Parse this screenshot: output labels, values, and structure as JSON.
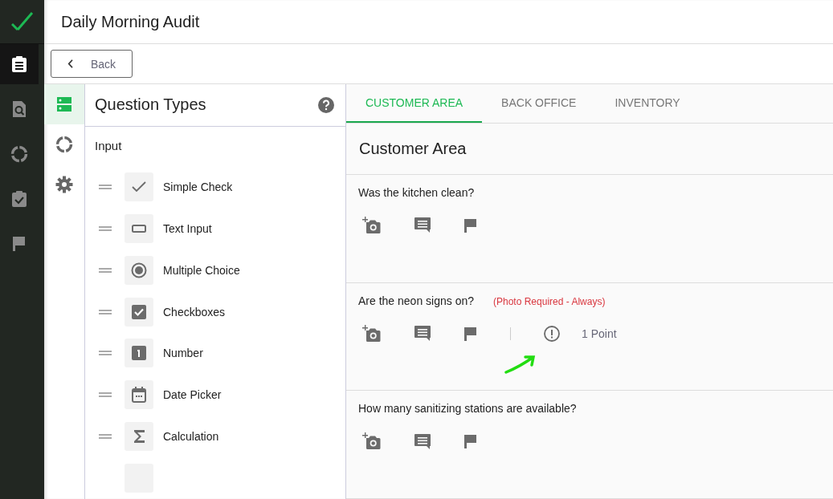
{
  "header": {
    "title": "Daily Morning Audit"
  },
  "back_button": {
    "label": "Back"
  },
  "nav": [
    {
      "kind": "clipboard",
      "selected": true
    },
    {
      "kind": "search",
      "selected": false
    },
    {
      "kind": "ring",
      "selected": false
    },
    {
      "kind": "check",
      "selected": false
    },
    {
      "kind": "flag",
      "selected": false
    }
  ],
  "side_tabs": [
    {
      "kind": "list",
      "selected": true
    },
    {
      "kind": "ring",
      "selected": false
    },
    {
      "kind": "gear",
      "selected": false
    }
  ],
  "question_types": {
    "title": "Question Types",
    "group": "Input",
    "items": [
      {
        "kind": "check",
        "label": "Simple Check"
      },
      {
        "kind": "text",
        "label": "Text Input"
      },
      {
        "kind": "radio",
        "label": "Multiple Choice"
      },
      {
        "kind": "checkbox",
        "label": "Checkboxes"
      },
      {
        "kind": "number",
        "label": "Number"
      },
      {
        "kind": "date",
        "label": "Date Picker"
      },
      {
        "kind": "sum",
        "label": "Calculation"
      },
      {
        "kind": "blank"
      }
    ]
  },
  "tabs": [
    {
      "label": "CUSTOMER AREA",
      "selected": true
    },
    {
      "label": "BACK OFFICE",
      "selected": false
    },
    {
      "label": "INVENTORY",
      "selected": false
    }
  ],
  "section_title": "Customer Area",
  "questions": [
    {
      "text": "Was the kitchen clean?"
    },
    {
      "text": "Are the neon signs on?",
      "note": "(Photo Required - Always)",
      "points": "1 Point",
      "annotated": true
    },
    {
      "text": "How many sanitizing stations are available?"
    }
  ]
}
